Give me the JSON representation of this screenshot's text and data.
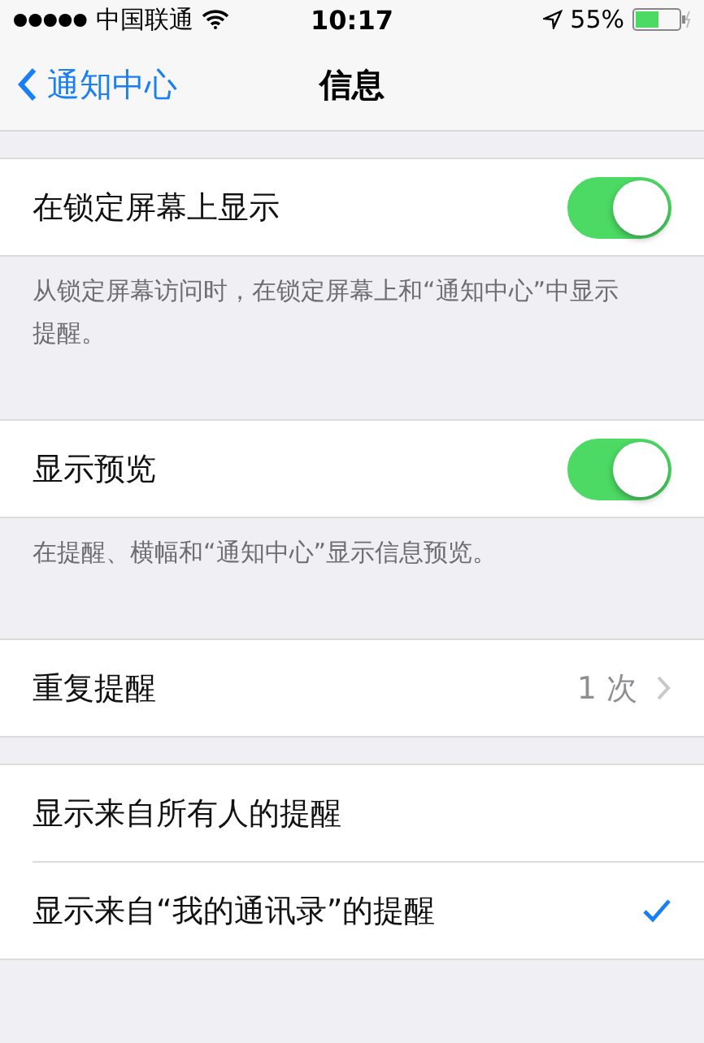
{
  "status_bar": {
    "carrier": "中国联通",
    "time": "10:17",
    "battery": "55%"
  },
  "nav": {
    "back": "通知中心",
    "title": "信息"
  },
  "groups": [
    {
      "rows": [
        {
          "kind": "toggle",
          "label": "在锁定屏幕上显示",
          "on": true
        }
      ],
      "footer": "从锁定屏幕访问时，在锁定屏幕上和“通知中心”中显示提醒。"
    },
    {
      "rows": [
        {
          "kind": "toggle",
          "label": "显示预览",
          "on": true
        }
      ],
      "footer": "在提醒、横幅和“通知中心”显示信息预览。"
    },
    {
      "rows": [
        {
          "kind": "value",
          "label": "重复提醒",
          "value": "1 次"
        }
      ]
    },
    {
      "rows": [
        {
          "kind": "check",
          "label": "显示来自所有人的提醒",
          "selected": false
        },
        {
          "kind": "check",
          "label": "显示来自“我的通讯录”的提醒",
          "selected": true
        }
      ]
    }
  ]
}
